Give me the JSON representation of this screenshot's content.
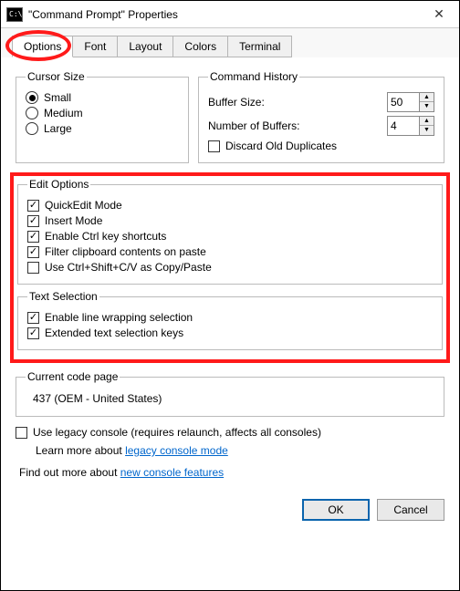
{
  "window": {
    "title": "\"Command Prompt\" Properties",
    "icon_glyph": "C:\\"
  },
  "tabs": {
    "t0": "Options",
    "t1": "Font",
    "t2": "Layout",
    "t3": "Colors",
    "t4": "Terminal"
  },
  "cursor": {
    "legend": "Cursor Size",
    "small": "Small",
    "medium": "Medium",
    "large": "Large"
  },
  "history": {
    "legend": "Command History",
    "buffer_label": "Buffer Size:",
    "buffer_value": "50",
    "num_label": "Number of Buffers:",
    "num_value": "4",
    "discard_label": "Discard Old Duplicates"
  },
  "edit": {
    "legend": "Edit Options",
    "quickedit": "QuickEdit Mode",
    "insert": "Insert Mode",
    "ctrlkeys": "Enable Ctrl key shortcuts",
    "filter": "Filter clipboard contents on paste",
    "ctrlshift": "Use Ctrl+Shift+C/V as Copy/Paste"
  },
  "textsel": {
    "legend": "Text Selection",
    "linewrap": "Enable line wrapping selection",
    "extkeys": "Extended text selection keys"
  },
  "codepage": {
    "legend": "Current code page",
    "value": "437  (OEM - United States)"
  },
  "legacy": {
    "label_pre": "Use legacy console (requires relaunch, affects all consoles)",
    "learn_pre": "Learn more about ",
    "learn_link": "legacy console mode"
  },
  "findout": {
    "pre": "Find out more about ",
    "link": "new console features"
  },
  "buttons": {
    "ok": "OK",
    "cancel": "Cancel"
  }
}
